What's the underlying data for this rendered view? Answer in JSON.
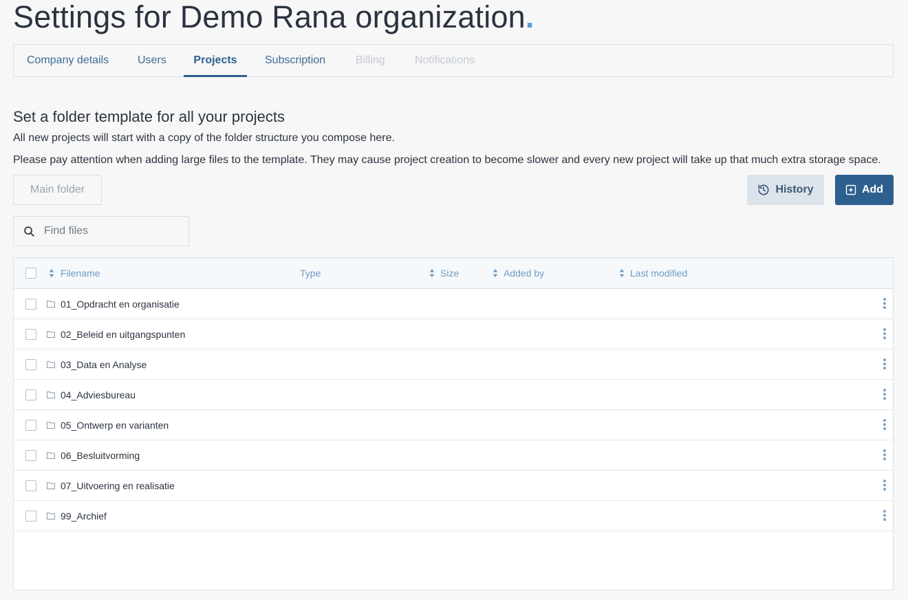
{
  "page": {
    "title": "Settings for Demo Rana organization",
    "title_dot": "."
  },
  "tabs": [
    {
      "label": "Company details",
      "state": "normal"
    },
    {
      "label": "Users",
      "state": "normal"
    },
    {
      "label": "Projects",
      "state": "active"
    },
    {
      "label": "Subscription",
      "state": "normal"
    },
    {
      "label": "Billing",
      "state": "disabled"
    },
    {
      "label": "Notifications",
      "state": "disabled"
    }
  ],
  "section": {
    "title": "Set a folder template for all your projects",
    "description1": "All new projects will start with a copy of the folder structure you compose here.",
    "description2": "Please pay attention when adding large files to the template. They may cause project creation to become slower and every new project will take up that much extra storage space."
  },
  "toolbar": {
    "breadcrumb_label": "Main folder",
    "history_label": "History",
    "add_label": "Add"
  },
  "search": {
    "placeholder": "Find files",
    "value": ""
  },
  "table": {
    "columns": {
      "filename": "Filename",
      "type": "Type",
      "size": "Size",
      "added_by": "Added by",
      "last_modified": "Last modified"
    },
    "rows": [
      {
        "name": "01_Opdracht en organisatie"
      },
      {
        "name": "02_Beleid en uitgangspunten"
      },
      {
        "name": "03_Data en Analyse"
      },
      {
        "name": "04_Adviesbureau"
      },
      {
        "name": "05_Ontwerp en varianten"
      },
      {
        "name": "06_Besluitvorming"
      },
      {
        "name": "07_Uitvoering en realisatie"
      },
      {
        "name": "99_Archief"
      }
    ]
  },
  "colors": {
    "primary": "#2d5f8f",
    "accent": "#5b9bd5",
    "header_text": "#6f9bc4",
    "disabled_text": "#c3c9d0"
  }
}
